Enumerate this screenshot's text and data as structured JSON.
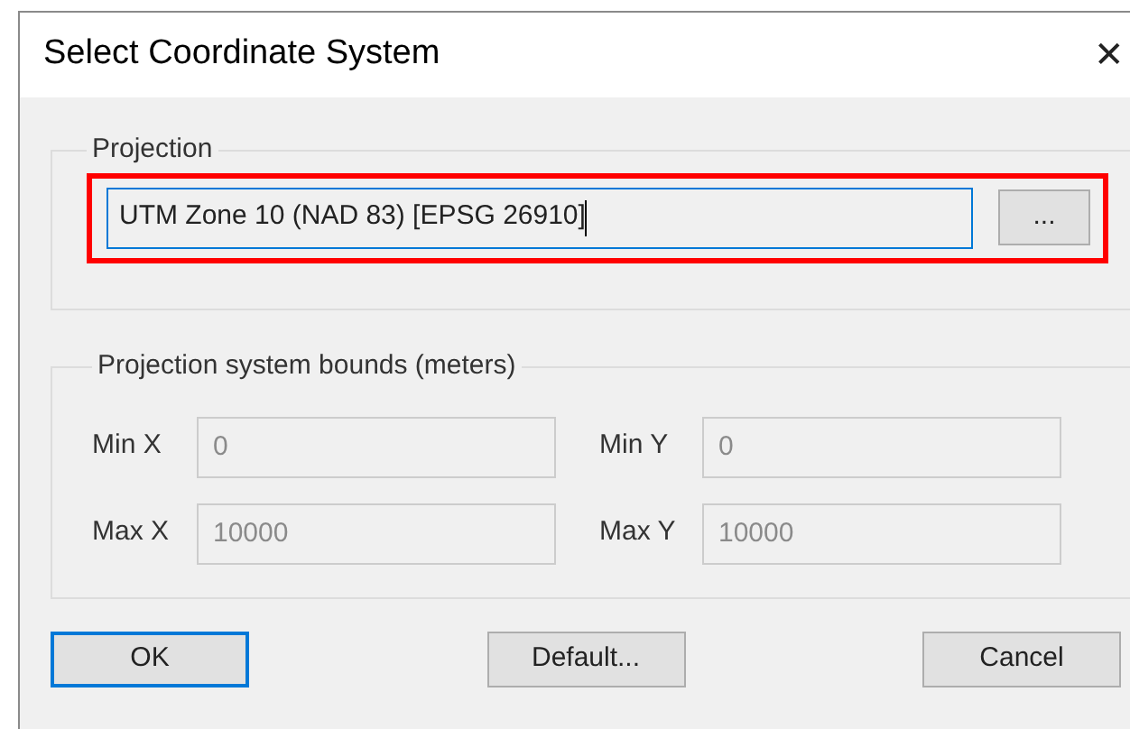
{
  "window": {
    "title": "Select Coordinate System",
    "close": "✕"
  },
  "projection": {
    "label": "Projection",
    "value": "UTM Zone 10 (NAD 83) [EPSG 26910]",
    "focused": true,
    "highlighted": true,
    "browse_button": "..."
  },
  "bounds": {
    "label": "Projection system bounds (meters)",
    "fields": [
      {
        "label": "Min X",
        "value": "0",
        "disabled": true
      },
      {
        "label": "Min Y",
        "value": "0",
        "disabled": true
      },
      {
        "label": "Max X",
        "value": "10000",
        "disabled": true
      },
      {
        "label": "Max Y",
        "value": "10000",
        "disabled": true
      }
    ]
  },
  "buttons": [
    {
      "label": "OK",
      "default": true
    },
    {
      "label": "Default...",
      "default": false
    },
    {
      "label": "Cancel",
      "default": false
    }
  ]
}
